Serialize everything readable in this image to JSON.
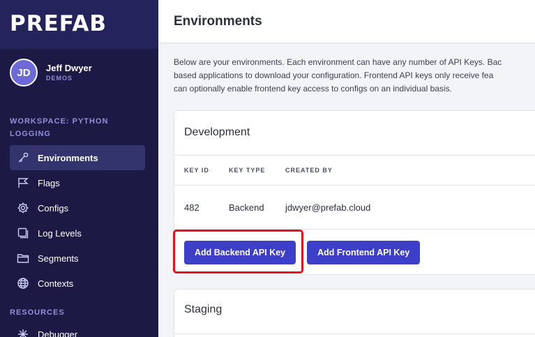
{
  "sidebar": {
    "logo": "PREFAB",
    "user": {
      "initials": "JD",
      "name": "Jeff Dwyer",
      "org": "DEMOS"
    },
    "workspace_label": "WORKSPACE: PYTHON LOGGING",
    "items": [
      {
        "label": "Environments",
        "icon": "key-icon",
        "active": true
      },
      {
        "label": "Flags",
        "icon": "flag-icon"
      },
      {
        "label": "Configs",
        "icon": "gear-icon"
      },
      {
        "label": "Log Levels",
        "icon": "log-icon"
      },
      {
        "label": "Segments",
        "icon": "folder-icon"
      },
      {
        "label": "Contexts",
        "icon": "globe-icon"
      }
    ],
    "resources_label": "RESOURCES",
    "debugger_label": "Debugger"
  },
  "header": {
    "title": "Environments"
  },
  "description": {
    "line1": "Below are your environments. Each environment can have any number of API Keys. Bac",
    "line2": "based applications to download your configuration. Frontend API keys only receive fea",
    "line3": "can optionally enable frontend key access to configs on an individual basis."
  },
  "development": {
    "title": "Development",
    "columns": [
      "KEY ID",
      "KEY TYPE",
      "CREATED BY"
    ],
    "rows": [
      {
        "id": "482",
        "type": "Backend",
        "created_by": "jdwyer@prefab.cloud"
      }
    ],
    "add_backend_label": "Add Backend API Key",
    "add_frontend_label": "Add Frontend API Key"
  },
  "staging": {
    "title": "Staging"
  },
  "colors": {
    "sidebar_bg": "#1c1a45",
    "accent": "#3d3fc9",
    "highlight": "#e8121a"
  }
}
